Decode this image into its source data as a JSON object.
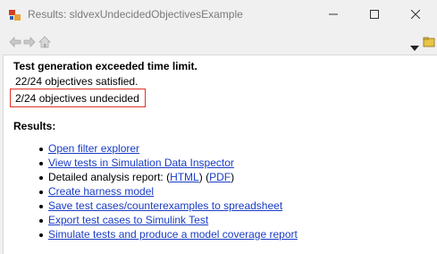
{
  "window": {
    "title": "Results: sldvexUndecidedObjectivesExample"
  },
  "toolbar": {
    "back": "back-arrow",
    "forward": "forward-arrow",
    "home": "home"
  },
  "summary": {
    "heading": "Test generation exceeded time limit.",
    "satisfied": "22/24 objectives satisfied.",
    "undecided": "2/24 objectives undecided",
    "highlight_color": "#e0312b"
  },
  "results": {
    "label": "Results:",
    "items": [
      {
        "text": "Open filter explorer"
      },
      {
        "text": "View tests in Simulation Data Inspector"
      },
      {
        "prefix": "Detailed analysis report: (",
        "html": "HTML",
        "mid": ") (",
        "pdf": "PDF",
        "suffix": ")"
      },
      {
        "text": "Create harness model"
      },
      {
        "text": "Save test cases/counterexamples to spreadsheet"
      },
      {
        "text": "Export test cases to Simulink Test"
      },
      {
        "text": "Simulate tests and produce a model coverage report"
      }
    ]
  },
  "colors": {
    "link": "#1a3cc4",
    "background": "#f0f0f0"
  }
}
